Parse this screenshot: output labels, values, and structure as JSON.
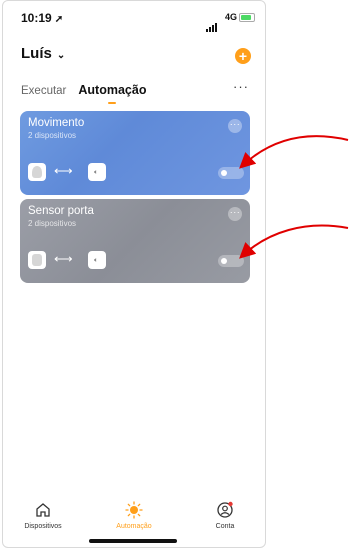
{
  "status": {
    "time": "10:19",
    "network": "4G"
  },
  "header": {
    "home_name": "Luís"
  },
  "tabs": [
    {
      "label": "Executar",
      "active": false
    },
    {
      "label": "Automação",
      "active": true
    }
  ],
  "automations": [
    {
      "name": "Movimento",
      "devices": "2 dispositivos",
      "enabled": false,
      "color": "#6f96e0"
    },
    {
      "name": "Sensor porta",
      "devices": "2 dispositivos",
      "enabled": false,
      "color": "#9597a0"
    }
  ],
  "nav": [
    {
      "label": "Dispositivos",
      "icon": "home-icon",
      "active": false
    },
    {
      "label": "Automação",
      "icon": "sun-icon",
      "active": true
    },
    {
      "label": "Conta",
      "icon": "account-icon",
      "active": false
    }
  ],
  "colors": {
    "accent": "#ff9f1a",
    "annotation_arrow": "#e00000"
  }
}
